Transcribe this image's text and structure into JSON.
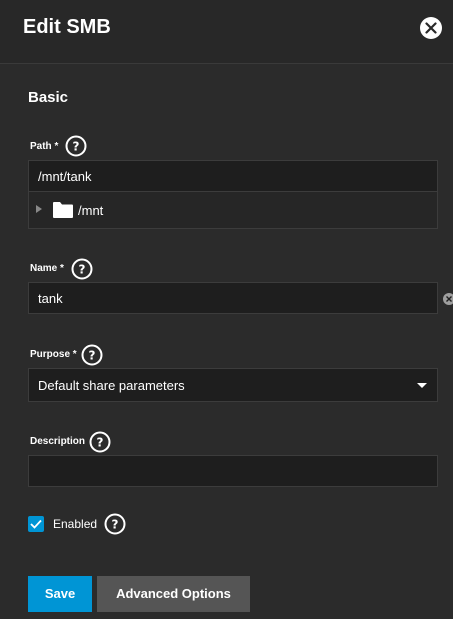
{
  "header": {
    "title": "Edit SMB",
    "close_icon": "close-icon"
  },
  "section": {
    "title": "Basic"
  },
  "fields": {
    "path": {
      "label": "Path *",
      "value": "/mnt/tank",
      "tree_item": "/mnt"
    },
    "name": {
      "label": "Name *",
      "value": "tank"
    },
    "purpose": {
      "label": "Purpose *",
      "value": "Default share parameters"
    },
    "description": {
      "label": "Description",
      "value": ""
    }
  },
  "enabled": {
    "label": "Enabled",
    "checked": true
  },
  "buttons": {
    "save": "Save",
    "advanced": "Advanced Options"
  },
  "colors": {
    "accent": "#0095d5",
    "background": "#282828",
    "input": "#1e1e1e",
    "secondary_button": "#555555"
  }
}
